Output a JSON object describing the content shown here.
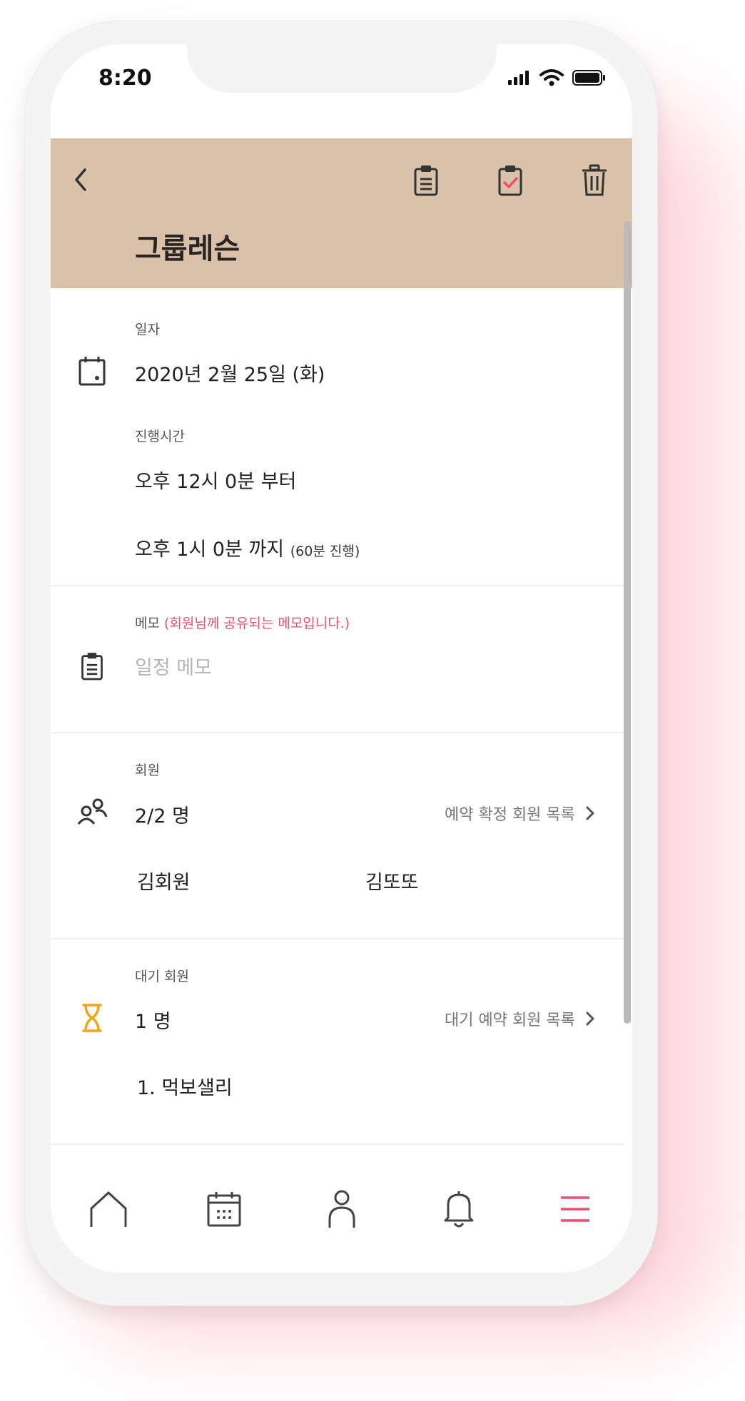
{
  "status_bar": {
    "time": "8:20"
  },
  "header": {
    "title": "그룹레슨",
    "actions": [
      "back-icon",
      "clipboard-icon",
      "clipboard-check-icon",
      "trash-icon"
    ]
  },
  "schedule": {
    "date_label": "일자",
    "date_value": "2020년 2월 25일 (화)",
    "time_label": "진행시간",
    "start": "오후 12시 0분 부터",
    "end": "오후 1시 0분 까지",
    "duration": "(60분 진행)"
  },
  "memo": {
    "label": "메모",
    "note": "(회원님께 공유되는 메모입니다.)",
    "placeholder": "일정 메모"
  },
  "members": {
    "label": "회원",
    "count": "2/2 명",
    "link": "예약 확정 회원 목록",
    "names": [
      "김회원",
      "김또또"
    ]
  },
  "waitlist": {
    "label": "대기 회원",
    "count": "1 명",
    "link": "대기 예약 회원 목록",
    "names": [
      "1. 먹보샐리"
    ]
  },
  "tab_bar": {
    "items": [
      "home-icon",
      "calendar-icon",
      "person-icon",
      "bell-icon",
      "menu-icon"
    ],
    "accent": "#e8506b"
  },
  "colors": {
    "header_bg": "#d9c1aa",
    "accent": "#e8506b",
    "hourglass": "#f4a31b"
  }
}
